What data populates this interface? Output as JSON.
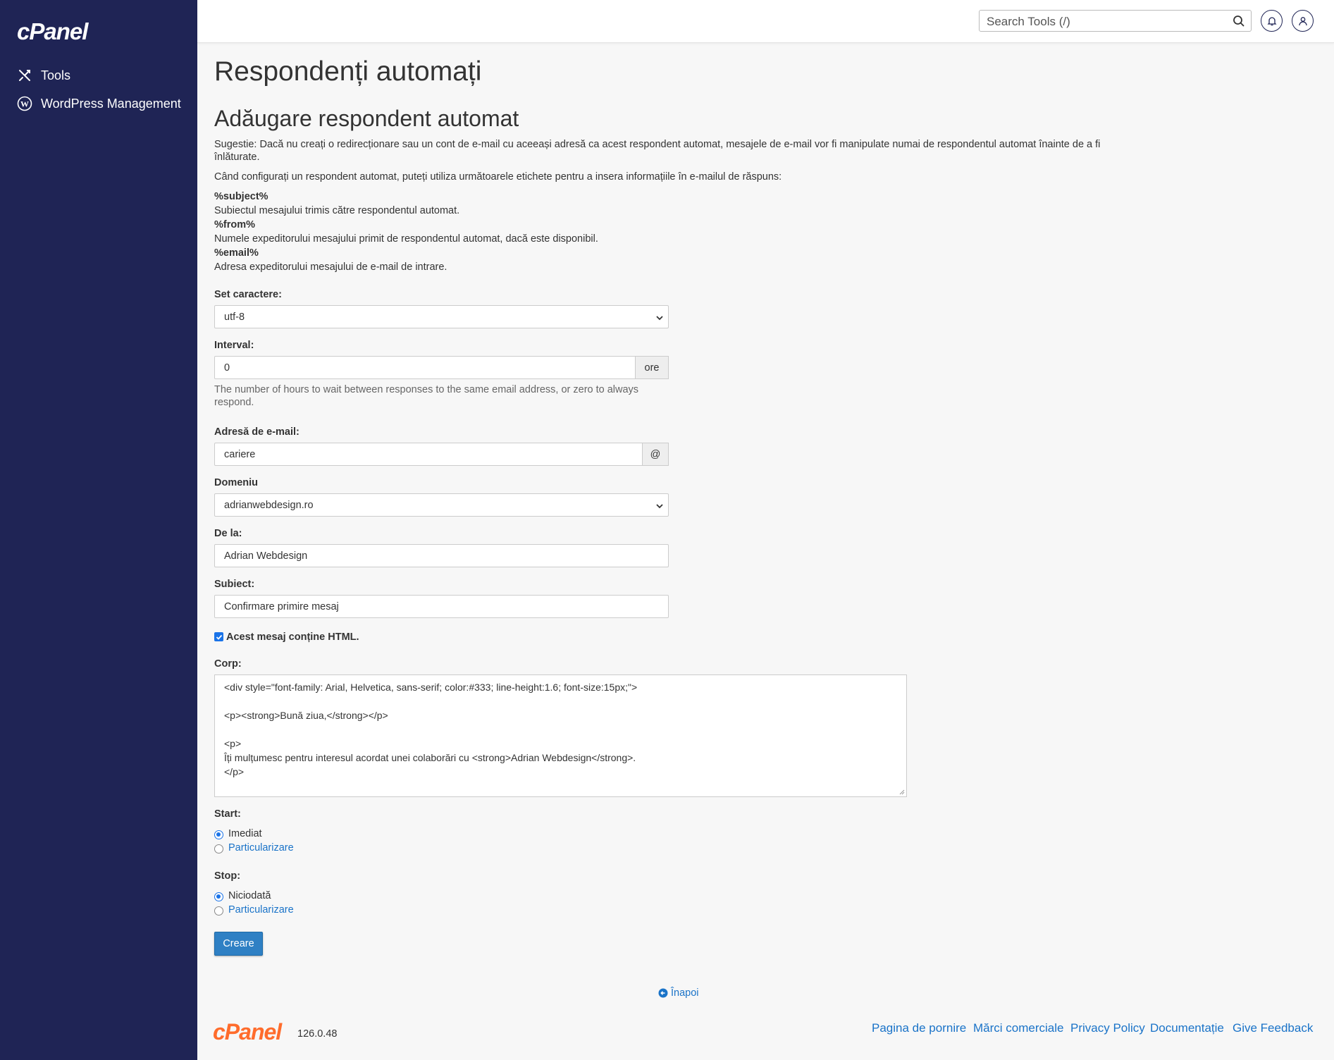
{
  "sidebar": {
    "brand": "cPanel",
    "items": [
      {
        "label": "Tools",
        "icon": "tools-icon"
      },
      {
        "label": "WordPress Management",
        "icon": "wordpress-icon"
      }
    ]
  },
  "topbar": {
    "search_placeholder": "Search Tools (/)"
  },
  "page": {
    "title": "Respondenți automați",
    "section_title": "Adăugare respondent automat",
    "suggestion": "Sugestie: Dacă nu creați o redirecționare sau un cont de e-mail cu aceeași adresă ca acest respondent automat, mesajele de e-mail vor fi manipulate numai de respondentul automat înainte de a fi înlăturate.",
    "tags_intro": "Când configurați un respondent automat, puteți utiliza următoarele etichete pentru a insera informațiile în e-mailul de răspuns:",
    "tags": [
      {
        "tag": "%subject%",
        "desc": "Subiectul mesajului trimis către respondentul automat."
      },
      {
        "tag": "%from%",
        "desc": "Numele expeditorului mesajului primit de respondentul automat, dacă este disponibil."
      },
      {
        "tag": "%email%",
        "desc": "Adresa expeditorului mesajului de e-mail de intrare."
      }
    ]
  },
  "form": {
    "charset_label": "Set caractere:",
    "charset_value": "utf-8",
    "interval_label": "Interval:",
    "interval_value": "0",
    "interval_addon": "ore",
    "interval_help": "The number of hours to wait between responses to the same email address, or zero to always respond.",
    "email_label": "Adresă de e-mail:",
    "email_value": "cariere",
    "email_addon": "@",
    "domain_label": "Domeniu",
    "domain_value": "adrianwebdesign.ro",
    "from_label": "De la:",
    "from_value": "Adrian Webdesign",
    "subject_label": "Subiect:",
    "subject_value": "Confirmare primire mesaj",
    "html_checkbox_label": "Acest mesaj conține HTML.",
    "html_checked": true,
    "body_label": "Corp:",
    "body_lines": [
      "<div style=\"font-family: Arial, Helvetica, sans-serif; color:#333; line-height:1.6; font-size:15px;\">",
      "",
      "<p><strong>Bună ziua,</strong></p>",
      "",
      "<p>",
      "Îți mulțumesc pentru interesul acordat unei colaborări cu <strong>Adrian Webdesign</strong>.",
      "</p>"
    ],
    "start_label": "Start:",
    "start_options": [
      {
        "label": "Imediat",
        "selected": true
      },
      {
        "label": "Particularizare",
        "selected": false
      }
    ],
    "stop_label": "Stop:",
    "stop_options": [
      {
        "label": "Niciodată",
        "selected": true
      },
      {
        "label": "Particularizare",
        "selected": false
      }
    ],
    "create_button": "Creare"
  },
  "back_link": "Înapoi",
  "footer": {
    "logo": "cPanel",
    "version": "126.0.48",
    "links": [
      "Pagina de pornire",
      "Mărci comerciale",
      "Privacy Policy",
      "Documentație",
      "Give Feedback"
    ]
  },
  "colors": {
    "sidebar": "#1f2455",
    "accent": "#2f80c4",
    "link": "#1a73c8",
    "brand_orange": "#ff6c2c"
  }
}
